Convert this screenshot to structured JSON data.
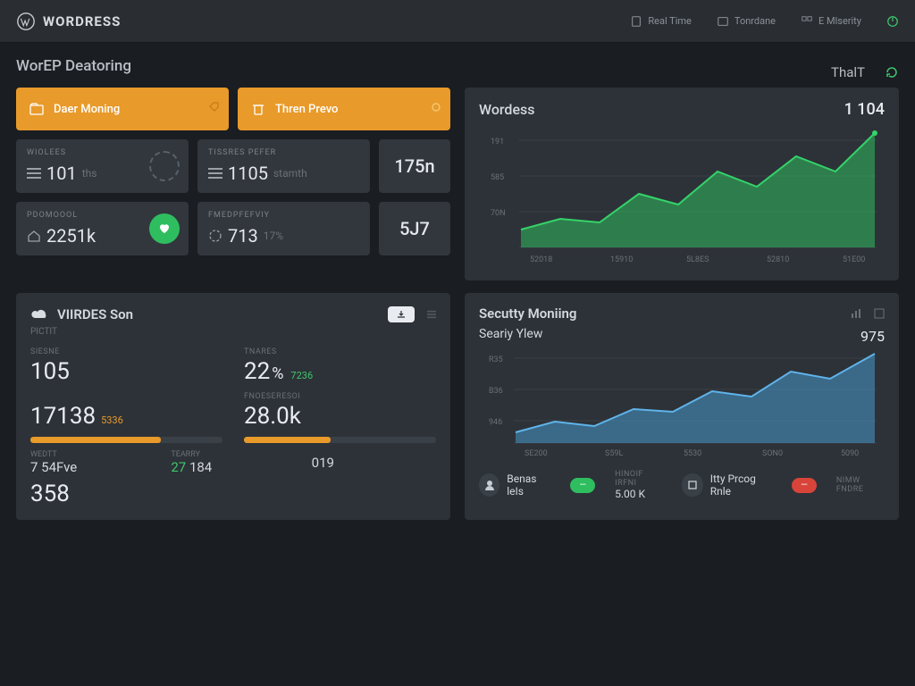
{
  "topbar": {
    "brand": "WORDRESS",
    "nav1": "Real Time",
    "nav2": "Tonrdane",
    "nav3": "E Mlserity"
  },
  "page_title": "WorEP Deatoring",
  "action_buttons": {
    "btn1": "Daer Moning",
    "btn2": "Thren Prevo"
  },
  "stats": {
    "s1_label": "WIOLEES",
    "s1_val": "101",
    "s1_sub": "ths",
    "s2_label": "TISSRES PEFER",
    "s2_val": "1105",
    "s2_sub": "stamth",
    "extra1": "175n",
    "s3_label": "PDOMOOOL",
    "s3_val": "2251k",
    "s4_label": "FMEDPFEFVIY",
    "s4_val": "713",
    "s4_sub": "17%",
    "extra2": "5J7"
  },
  "right_header": "ThalT",
  "chart_top": {
    "title": "Wordess",
    "value": "1 104"
  },
  "chart_data": {
    "type": "area",
    "title": "Wordess",
    "x_ticks": [
      "52018",
      "15910",
      "5L8ES",
      "52810",
      "51E00"
    ],
    "y_ticks": [
      "191",
      "585",
      "70N"
    ],
    "ylim": [
      0,
      200
    ],
    "values": [
      45,
      60,
      55,
      95,
      78,
      130,
      105,
      160,
      135,
      195
    ]
  },
  "panel_left": {
    "title": "VIIRDES Son",
    "sub": "PICTIT",
    "m1_label": "SIESNE",
    "m1_val": "105",
    "m2_label": "TNARES",
    "m2_val": "22",
    "m2_delta": "7236",
    "m3_label": "",
    "m3_val": "17138",
    "m3_delta": "5336",
    "m4_label": "FNOESERESOI",
    "m4_val": "28.0k",
    "b1_label": "WEDTT",
    "b1_val": "7 54Fve",
    "b2_label": "TEARRY",
    "b2_val": "27",
    "b2_sub": "184",
    "b3_label": "",
    "b3_val": "019",
    "big": "358"
  },
  "panel_right": {
    "title": "Secutty Moniing",
    "chart2_title": "Seariy Ylew",
    "chart2_value": "975",
    "chart2_data": {
      "type": "area",
      "x_ticks": [
        "SE200",
        "S59L",
        "5530",
        "SON0",
        "5090"
      ],
      "y_ticks": [
        "R35",
        "B36",
        "946"
      ],
      "ylim": [
        0,
        180
      ],
      "values": [
        30,
        50,
        42,
        70,
        65,
        100,
        90,
        140,
        125,
        175
      ]
    },
    "f1_label": "Benas leIs",
    "f1_val": "",
    "f2_label": "HINOIF IRFNI",
    "f2_val": "5.00 K",
    "f3_label": "Itty Prcog Rnle",
    "f4_label": "NIMW FNDRE"
  }
}
